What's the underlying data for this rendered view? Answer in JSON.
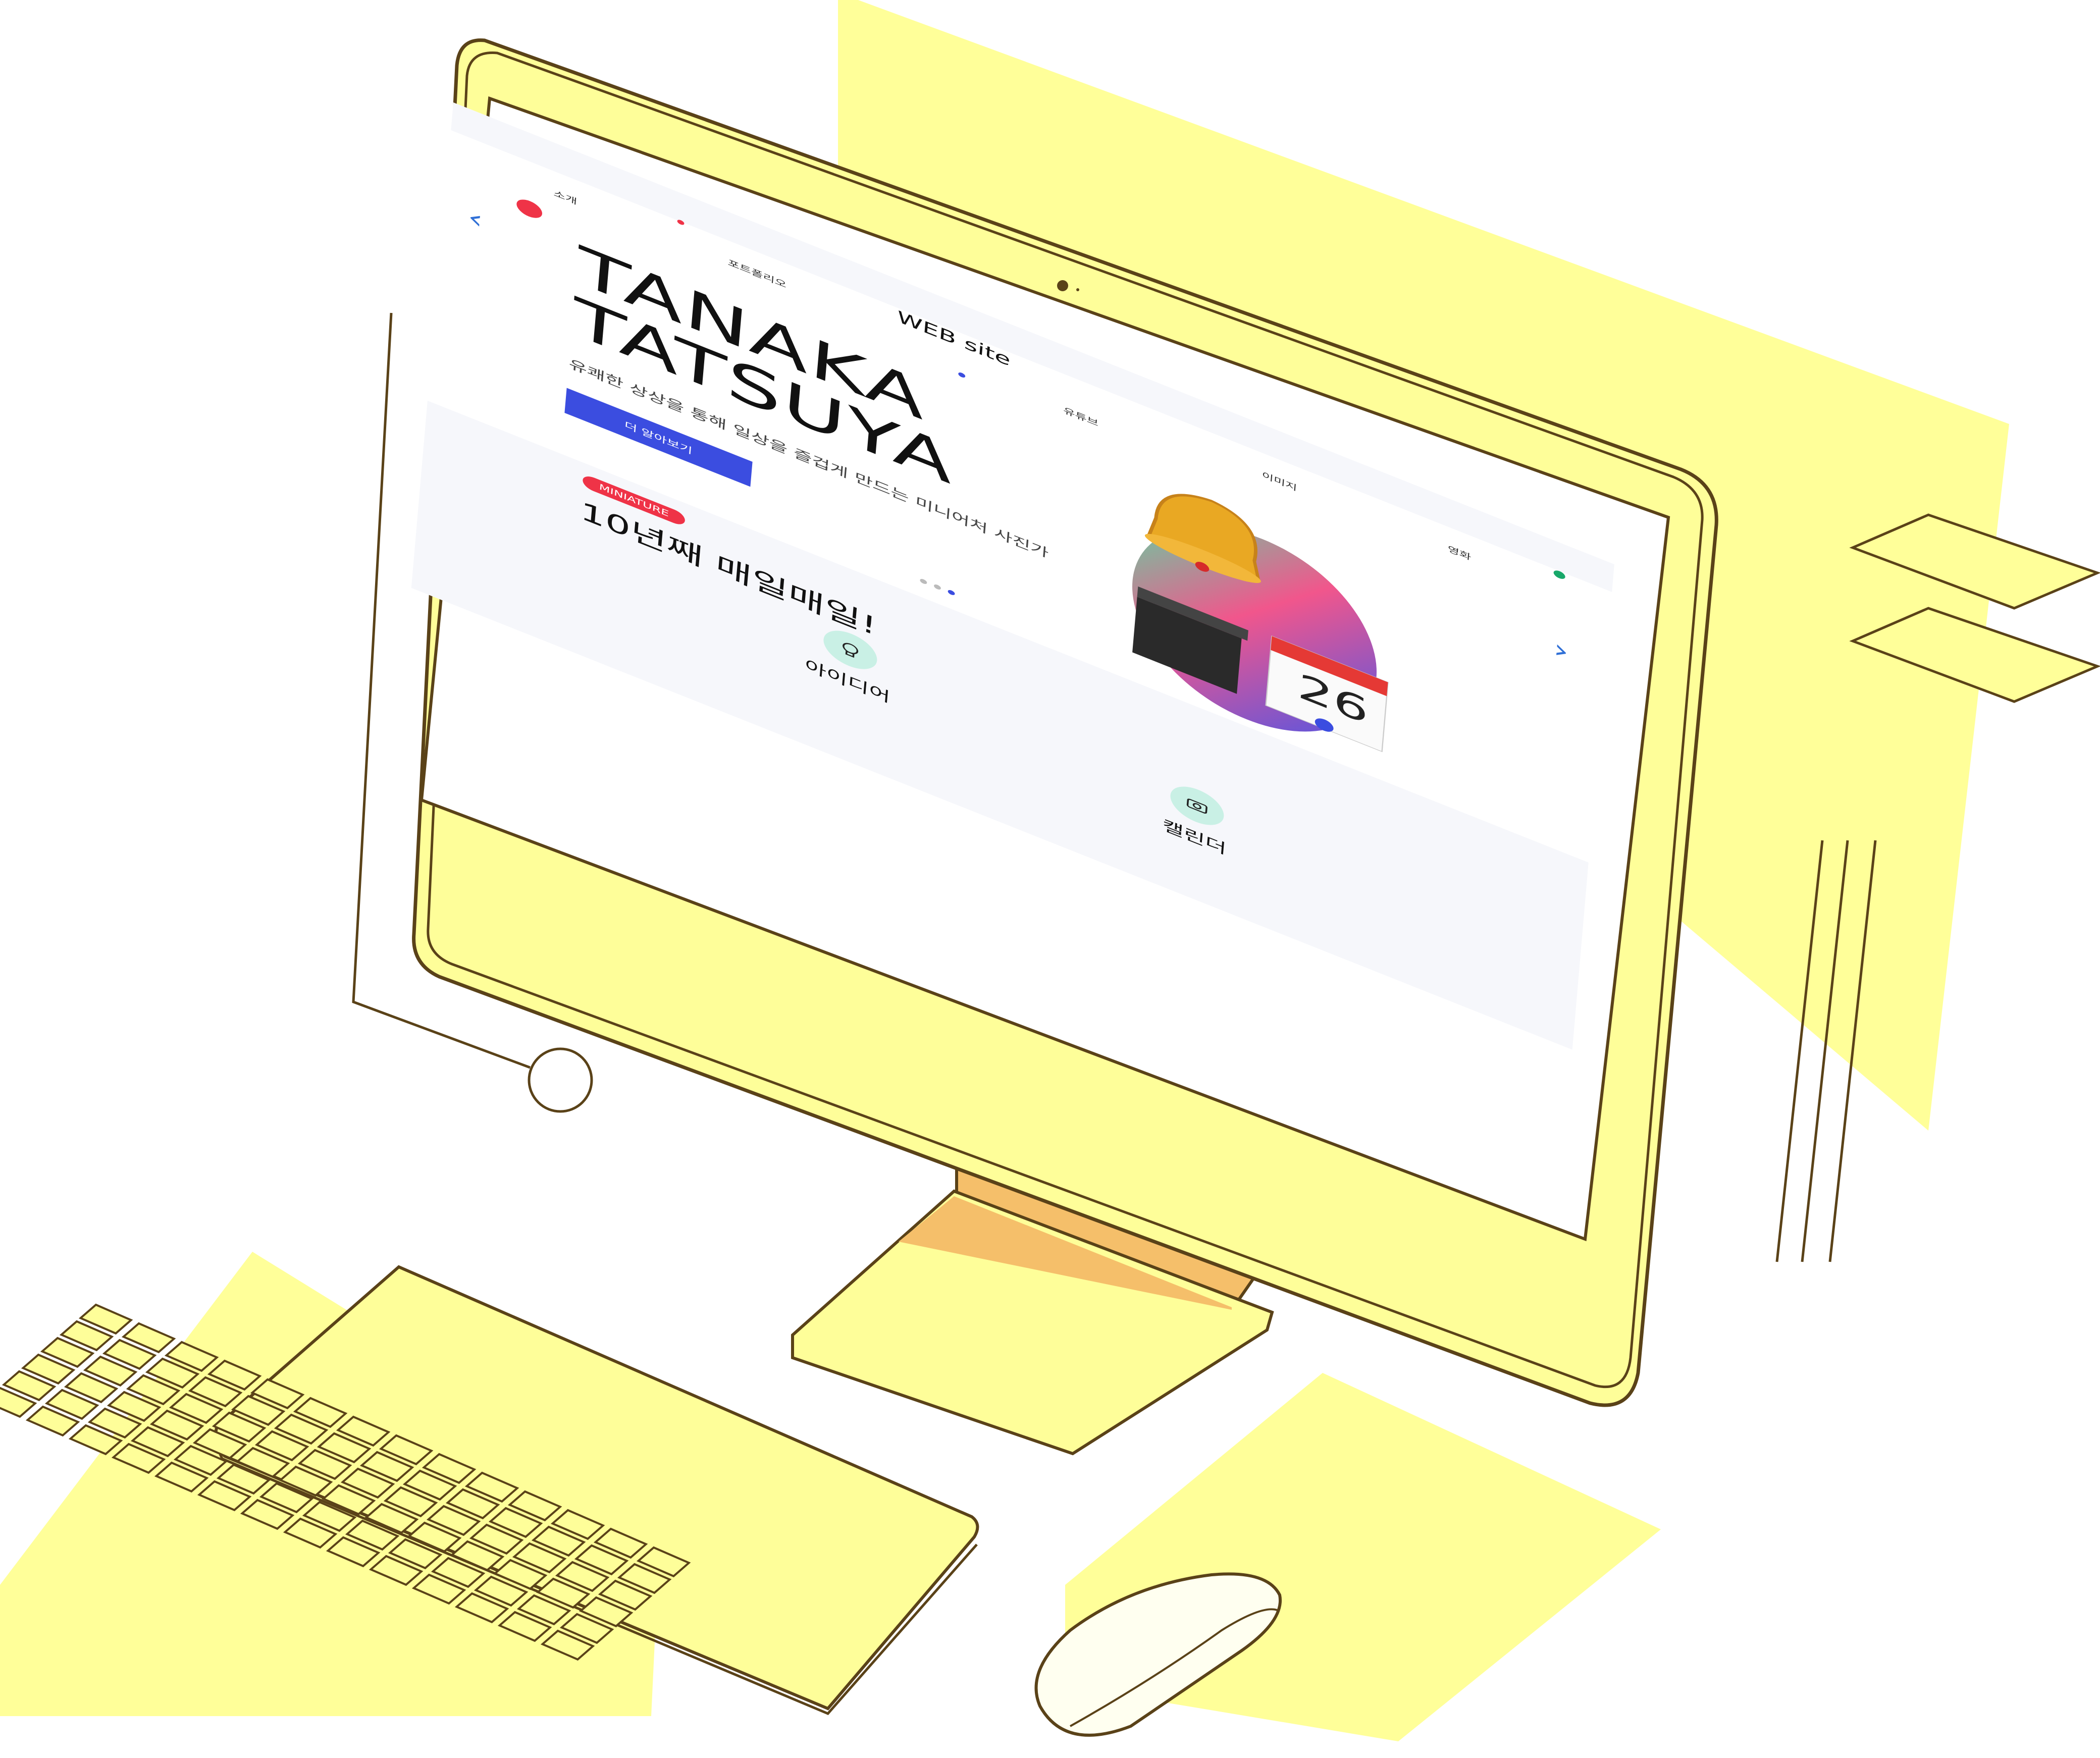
{
  "site": {
    "title": "WEB site",
    "nav": [
      "소개",
      "포트폴리오",
      "유튜브",
      "이미지",
      "영화"
    ],
    "hero": {
      "title_line1": "TANAKA",
      "title_line2": "TATSUYA",
      "subtitle": "유쾌한 상상을 통해 일상을 즐겁게 만드는 미니어처 사진가",
      "button": "더 알아보기"
    },
    "badge": "MINIATURE",
    "section_title": "10년째 매일매일!",
    "features": [
      {
        "label": "아이디어",
        "icon": "lightbulb-icon"
      },
      {
        "label": "캘린더",
        "icon": "camera-icon"
      }
    ],
    "calendar_number": "26"
  },
  "colors": {
    "monitor": "#fefe99",
    "outline": "#5a4218",
    "accent_blue": "#3b4de0",
    "accent_red": "#ef3347",
    "stand_shadow": "#f5bf6a",
    "background_shape": "#ffff99"
  }
}
